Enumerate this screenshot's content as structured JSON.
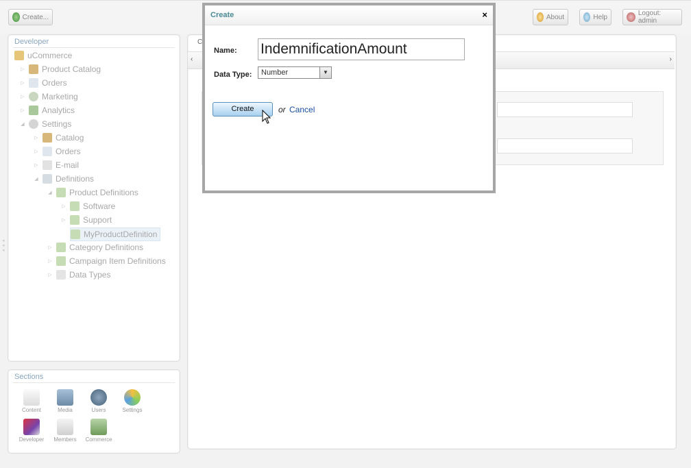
{
  "toolbar": {
    "create_label": "Create...",
    "about_label": "About",
    "help_label": "Help",
    "logout_label": "Logout: admin"
  },
  "developer_panel": {
    "title": "Developer",
    "tree": [
      {
        "label": "uCommerce"
      },
      {
        "label": "Product Catalog"
      },
      {
        "label": "Orders"
      },
      {
        "label": "Marketing"
      },
      {
        "label": "Analytics"
      },
      {
        "label": "Settings"
      },
      {
        "label": "Catalog"
      },
      {
        "label": "Orders"
      },
      {
        "label": "E-mail"
      },
      {
        "label": "Definitions"
      },
      {
        "label": "Product Definitions"
      },
      {
        "label": "Software"
      },
      {
        "label": "Support"
      },
      {
        "label": "MyProductDefinition"
      },
      {
        "label": "Category Definitions"
      },
      {
        "label": "Campaign Item Definitions"
      },
      {
        "label": "Data Types"
      }
    ]
  },
  "sections_panel": {
    "title": "Sections",
    "items": [
      {
        "label": "Content"
      },
      {
        "label": "Media"
      },
      {
        "label": "Users"
      },
      {
        "label": "Settings"
      },
      {
        "label": "Developer"
      },
      {
        "label": "Members"
      },
      {
        "label": "Commerce"
      }
    ]
  },
  "main_panel": {
    "tab_initial": "C"
  },
  "dialog": {
    "title": "Create",
    "close_glyph": "×",
    "name_label": "Name:",
    "name_value": "IndemnificationAmount",
    "datatype_label": "Data Type:",
    "datatype_value": "Number",
    "create_button": "Create",
    "or_text": "or",
    "cancel_link": "Cancel"
  },
  "colors": {
    "accent_blue": "#8aa6c0",
    "dialog_title": "#4a8a94",
    "link": "#1a4fa0"
  }
}
